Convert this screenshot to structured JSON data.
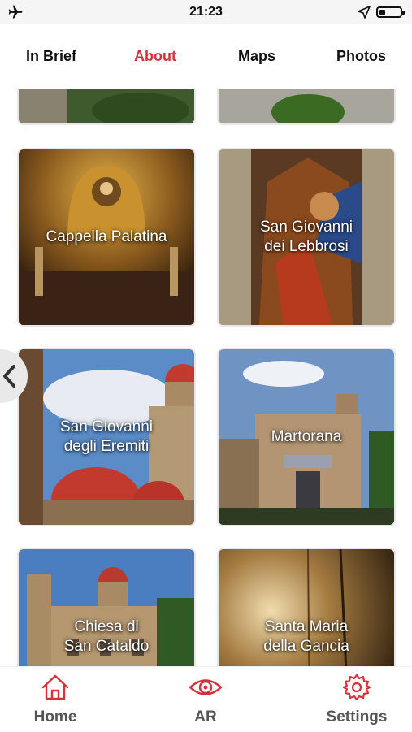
{
  "status_bar": {
    "time": "21:23",
    "icons": [
      "airplane-icon",
      "location-arrow-icon",
      "battery-icon"
    ],
    "battery_level": 0.3
  },
  "tabs": [
    {
      "label": "In Brief",
      "active": false
    },
    {
      "label": "About",
      "active": true
    },
    {
      "label": "Maps",
      "active": false
    },
    {
      "label": "Photos",
      "active": false
    }
  ],
  "grid": {
    "items": [
      {
        "label": ""
      },
      {
        "label": ""
      },
      {
        "label": "Cappella Palatina"
      },
      {
        "label": "San Giovanni\ndei Lebbrosi"
      },
      {
        "label": "San Giovanni\ndegli Eremiti"
      },
      {
        "label": "Martorana"
      },
      {
        "label": "Chiesa di\nSan Cataldo"
      },
      {
        "label": "Santa Maria\ndella Gancia"
      }
    ]
  },
  "side_nav": {
    "icon": "chevron-left-icon"
  },
  "bottom_nav": [
    {
      "label": "Home",
      "icon": "home-icon"
    },
    {
      "label": "AR",
      "icon": "eye-icon"
    },
    {
      "label": "Settings",
      "icon": "settings-gear-icon"
    }
  ],
  "colors": {
    "accent": "#d4313c",
    "status_bar_bg": "#f5f5f5"
  }
}
